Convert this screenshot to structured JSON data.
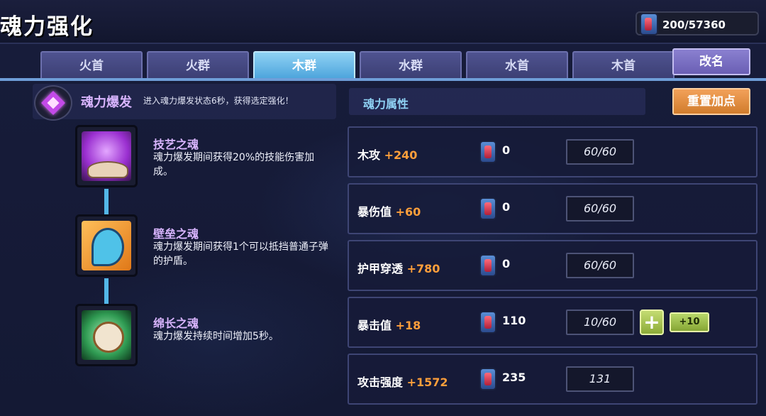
{
  "header": {
    "title": "魂力强化",
    "currency": {
      "icon": "soul-gem-icon",
      "value": "200/57360"
    }
  },
  "tabs": [
    {
      "label": "火首",
      "active": false
    },
    {
      "label": "火群",
      "active": false
    },
    {
      "label": "木群",
      "active": true
    },
    {
      "label": "水群",
      "active": false
    },
    {
      "label": "水首",
      "active": false
    },
    {
      "label": "木首",
      "active": false
    }
  ],
  "rename_label": "改名",
  "burst": {
    "icon": "soul-burst-emblem-icon",
    "title": "魂力爆发",
    "description": "进入魂力爆发状态6秒，获得选定强化！"
  },
  "skills": [
    {
      "icon": "craft-soul-icon",
      "name": "技艺之魂",
      "description": "魂力爆发期间获得20%的技能伤害加成。"
    },
    {
      "icon": "barrier-soul-icon",
      "name": "壁垒之魂",
      "description": "魂力爆发期间获得1个可以抵挡普通子弹的护盾。"
    },
    {
      "icon": "lasting-soul-icon",
      "name": "绵长之魂",
      "description": "魂力爆发持续时间增加5秒。"
    }
  ],
  "attributes_panel": {
    "title": "魂力属性",
    "reset_label": "重置加点",
    "rows": [
      {
        "name": "木攻",
        "bonus": "+240",
        "cost": "0",
        "progress": "60/60"
      },
      {
        "name": "暴伤值",
        "bonus": "+60",
        "cost": "0",
        "progress": "60/60"
      },
      {
        "name": "护甲穿透",
        "bonus": "+780",
        "cost": "0",
        "progress": "60/60"
      },
      {
        "name": "暴击值",
        "bonus": "+18",
        "cost": "110",
        "progress": "10/60",
        "plus_label": "+",
        "plus_ten_label": "+10"
      },
      {
        "name": "攻击强度",
        "bonus": "+1572",
        "cost": "235",
        "progress": "131"
      }
    ]
  },
  "colors": {
    "background": "#141934",
    "tab_active": "#4ea5dc",
    "tab_inactive": "#3c3f74",
    "bonus_text": "#ff9f3b",
    "skill_name": "#d9b5ff",
    "reset_button": "#d17c2c",
    "plus_button": "#8cab38"
  }
}
